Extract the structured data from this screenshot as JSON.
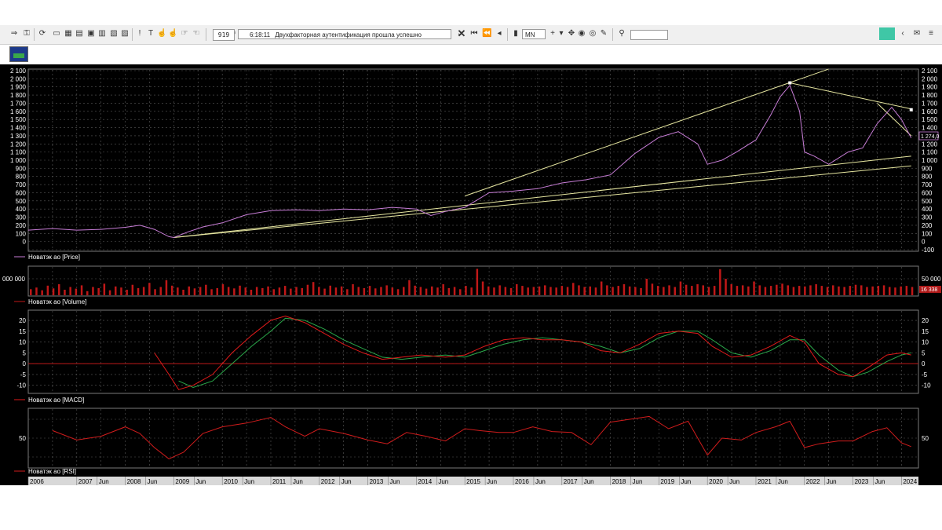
{
  "toolbar": {
    "time_value": "919",
    "message_time": "6:18:11",
    "message": "Двухфакторная аутентификация прошла успешно",
    "timeframe": "MN"
  },
  "chart_data": [
    {
      "type": "line",
      "legend": "Новатэк ао [Price]",
      "ylim": [
        -100,
        2100
      ],
      "yticks": [
        -100,
        0,
        100,
        200,
        300,
        400,
        500,
        600,
        700,
        800,
        900,
        1000,
        1100,
        1200,
        1300,
        1400,
        1500,
        1600,
        1700,
        1800,
        1900,
        2000,
        2100
      ],
      "ytick_labels_left": [
        "0",
        "100",
        "200",
        "300",
        "400",
        "500",
        "600",
        "700",
        "800",
        "900",
        "1 000",
        "1 100",
        "1 200",
        "1 300",
        "1 400",
        "1 500",
        "1 600",
        "1 700",
        "1 800",
        "1 900",
        "2 000",
        "2 100"
      ],
      "ytick_labels_right": [
        "-100",
        "0",
        "100",
        "200",
        "300",
        "400",
        "500",
        "600",
        "700",
        "800",
        "900",
        "1 000",
        "1 100",
        "1 200",
        "1 300",
        "1 400",
        "1 500",
        "1 600",
        "1 700",
        "1 800",
        "1 900",
        "2 000",
        "2 100"
      ],
      "last_value_label": "1 274,0",
      "x": [
        2006.0,
        2006.5,
        2007.0,
        2007.5,
        2008.0,
        2008.3,
        2008.6,
        2008.9,
        2009.0,
        2009.3,
        2009.6,
        2010.0,
        2010.5,
        2011.0,
        2011.5,
        2012.0,
        2012.5,
        2013.0,
        2013.5,
        2014.0,
        2014.3,
        2014.6,
        2015.0,
        2015.5,
        2016.0,
        2016.5,
        2017.0,
        2017.5,
        2018.0,
        2018.5,
        2019.0,
        2019.4,
        2019.8,
        2020.0,
        2020.3,
        2020.6,
        2021.0,
        2021.3,
        2021.5,
        2021.7,
        2021.9,
        2022.0,
        2022.2,
        2022.5,
        2022.9,
        2023.2,
        2023.5,
        2023.8,
        2024.0,
        2024.2
      ],
      "values": [
        140,
        160,
        140,
        150,
        175,
        200,
        150,
        60,
        50,
        120,
        180,
        230,
        330,
        380,
        390,
        380,
        400,
        390,
        420,
        400,
        320,
        370,
        420,
        600,
        620,
        650,
        720,
        760,
        820,
        1080,
        1280,
        1350,
        1200,
        950,
        1000,
        1100,
        1250,
        1550,
        1780,
        1920,
        1600,
        1100,
        1050,
        950,
        1100,
        1150,
        1450,
        1650,
        1500,
        1274
      ],
      "trend_lines": [
        {
          "from": [
            2009.0,
            50
          ],
          "to": [
            2024.2,
            1050
          ]
        },
        {
          "from": [
            2009.0,
            50
          ],
          "to": [
            2024.2,
            930
          ]
        },
        {
          "from": [
            2015.0,
            560
          ],
          "to": [
            2022.5,
            2120
          ]
        },
        {
          "from": [
            2021.7,
            1950
          ],
          "to": [
            2024.2,
            1630
          ]
        },
        {
          "from": [
            2023.5,
            1700
          ],
          "to": [
            2024.2,
            1300
          ]
        }
      ],
      "pivot_points": [
        [
          2021.7,
          1950
        ],
        [
          2024.2,
          1620
        ]
      ]
    },
    {
      "type": "bar",
      "legend": "Новатэк ао [Volume]",
      "ytick_label_left": "000 000",
      "ytick_label_right": "50 000",
      "last_value_label": "16 338",
      "values": [
        0.22,
        0.28,
        0.18,
        0.35,
        0.25,
        0.4,
        0.2,
        0.3,
        0.24,
        0.36,
        0.15,
        0.3,
        0.26,
        0.42,
        0.18,
        0.32,
        0.28,
        0.2,
        0.38,
        0.26,
        0.3,
        0.45,
        0.22,
        0.3,
        0.55,
        0.35,
        0.28,
        0.2,
        0.32,
        0.25,
        0.3,
        0.38,
        0.22,
        0.26,
        0.4,
        0.3,
        0.25,
        0.35,
        0.28,
        0.2,
        0.3,
        0.26,
        0.32,
        0.22,
        0.28,
        0.34,
        0.24,
        0.3,
        0.26,
        0.38,
        0.48,
        0.3,
        0.24,
        0.35,
        0.28,
        0.32,
        0.22,
        0.4,
        0.3,
        0.26,
        0.34,
        0.25,
        0.3,
        0.36,
        0.28,
        0.22,
        0.3,
        0.55,
        0.35,
        0.3,
        0.24,
        0.32,
        0.28,
        0.4,
        0.26,
        0.3,
        0.22,
        0.34,
        0.28,
        0.96,
        0.5,
        0.32,
        0.28,
        0.36,
        0.3,
        0.26,
        0.4,
        0.34,
        0.28,
        0.3,
        0.32,
        0.36,
        0.3,
        0.28,
        0.34,
        0.3,
        0.45,
        0.36,
        0.3,
        0.32,
        0.28,
        0.5,
        0.36,
        0.3,
        0.34,
        0.4,
        0.32,
        0.3,
        0.26,
        0.6,
        0.42,
        0.34,
        0.3,
        0.36,
        0.3,
        0.5,
        0.38,
        0.34,
        0.4,
        0.36,
        0.3,
        0.34,
        0.95,
        0.6,
        0.4,
        0.34,
        0.36,
        0.32,
        0.5,
        0.36,
        0.3,
        0.34,
        0.38,
        0.42,
        0.36,
        0.3,
        0.34,
        0.32,
        0.36,
        0.4,
        0.34,
        0.3,
        0.36,
        0.32,
        0.3,
        0.34,
        0.38,
        0.36,
        0.3,
        0.32,
        0.34,
        0.36,
        0.3,
        0.28,
        0.32,
        0.34,
        0.3
      ]
    },
    {
      "type": "line",
      "legend": "Новатэк ао [MACD]",
      "ylim": [
        -13,
        24
      ],
      "yticks": [
        -10,
        -5,
        0,
        5,
        10,
        15,
        20
      ],
      "ytick_labels": [
        "-10",
        "-5",
        "0",
        "5",
        "10",
        "15",
        "20"
      ],
      "x": [
        2008.6,
        2008.9,
        2009.1,
        2009.4,
        2009.8,
        2010.2,
        2010.6,
        2011.0,
        2011.3,
        2011.7,
        2012.1,
        2012.5,
        2012.9,
        2013.3,
        2013.7,
        2014.1,
        2014.6,
        2015.0,
        2015.4,
        2015.8,
        2016.2,
        2016.6,
        2017.0,
        2017.4,
        2017.8,
        2018.2,
        2018.6,
        2019.0,
        2019.4,
        2019.8,
        2020.1,
        2020.5,
        2020.9,
        2021.3,
        2021.7,
        2022.0,
        2022.3,
        2022.7,
        2023.0,
        2023.3,
        2023.7,
        2024.0,
        2024.2
      ],
      "series": [
        {
          "values": [
            5,
            -5,
            -12,
            -10,
            -5,
            5,
            13,
            20,
            22,
            19,
            14,
            9,
            5,
            2,
            3,
            4,
            3,
            4,
            8,
            11,
            12,
            11,
            11,
            10,
            6,
            5,
            9,
            14,
            15,
            14,
            8,
            3,
            4,
            8,
            13,
            10,
            0,
            -5,
            -6,
            -2,
            4,
            5,
            4
          ]
        },
        {
          "values": [
            null,
            null,
            -8,
            -11,
            -8,
            0,
            8,
            15,
            21,
            20,
            16,
            11,
            7,
            3,
            2,
            3,
            4,
            3,
            6,
            9,
            11,
            12,
            11,
            10,
            8,
            5,
            7,
            12,
            15,
            15,
            11,
            5,
            3,
            6,
            11,
            11,
            4,
            -3,
            -6,
            -4,
            1,
            4,
            5
          ]
        }
      ]
    },
    {
      "type": "line",
      "legend": "Новатэк ао [RSI]",
      "ytick_labels": [
        "50"
      ],
      "x": [
        2006.5,
        2007.0,
        2007.5,
        2008.0,
        2008.3,
        2008.6,
        2008.9,
        2009.2,
        2009.6,
        2010.0,
        2010.5,
        2011.0,
        2011.3,
        2011.7,
        2012.0,
        2012.5,
        2013.0,
        2013.4,
        2013.8,
        2014.2,
        2014.6,
        2015.0,
        2015.3,
        2015.7,
        2016.0,
        2016.4,
        2016.8,
        2017.2,
        2017.6,
        2018.0,
        2018.4,
        2018.8,
        2019.2,
        2019.6,
        2020.0,
        2020.3,
        2020.7,
        2021.0,
        2021.4,
        2021.7,
        2022.0,
        2022.3,
        2022.7,
        2023.0,
        2023.4,
        2023.7,
        2024.0,
        2024.2
      ],
      "series": [
        {
          "values": [
            58,
            48,
            52,
            62,
            55,
            40,
            28,
            35,
            55,
            62,
            66,
            72,
            62,
            52,
            60,
            55,
            48,
            44,
            56,
            52,
            47,
            60,
            58,
            56,
            56,
            62,
            57,
            56,
            43,
            67,
            70,
            73,
            60,
            68,
            32,
            50,
            48,
            56,
            62,
            68,
            40,
            44,
            47,
            47,
            57,
            61,
            45,
            41
          ]
        }
      ]
    }
  ],
  "legends": {
    "price": "Новатэк ао [Price]",
    "volume": "Новатэк ао [Volume]",
    "macd": "Новатэк ао [MACD]",
    "rsi": "Новатэк ао [RSI]"
  },
  "time_axis": {
    "labels": [
      "2006",
      "2007",
      "Jun",
      "2008",
      "Jun",
      "2009",
      "Jun",
      "2010",
      "Jun",
      "2011",
      "Jun",
      "2012",
      "Jun",
      "2013",
      "Jun",
      "2014",
      "Jun",
      "2015",
      "Jun",
      "2016",
      "Jun",
      "2017",
      "Jun",
      "2018",
      "Jun",
      "2019",
      "Jun",
      "2020",
      "Jun",
      "2021",
      "Jun",
      "2022",
      "Jun",
      "2023",
      "Jun",
      "2024"
    ]
  },
  "colors": {
    "background": "#000000",
    "grid": "#5a5a5a",
    "price": "#c77dd6",
    "trend": "#e6e6a0",
    "volume": "#c01818",
    "macd": "#e01a1a",
    "signal": "#2aa84a",
    "rsi": "#d01c1c"
  }
}
